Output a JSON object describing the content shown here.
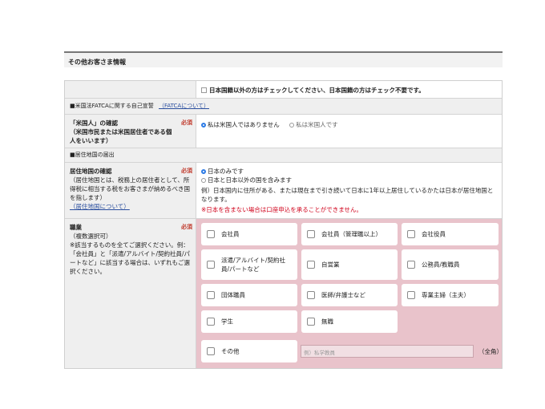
{
  "section_title": "その他お客さま情報",
  "nationality_check_label": "日本国籍以外の方はチェックしてください、日本国籍の方はチェック不要です。",
  "fatca": {
    "label": "■米国法FATCAに関する自己宣誓",
    "link": "（FATCAについて）"
  },
  "us_person": {
    "title": "「米国人」の確認",
    "desc": "（米国市民または米国居住者である個人をいいます）",
    "required": "必須",
    "option_no": "私は米国人ではありません",
    "option_yes": "私は米国人です",
    "selected": "option_no"
  },
  "residence_header": "■居住地国の届出",
  "residence": {
    "title": "居住地国の確認",
    "required": "必須",
    "desc": "（居住地国とは、税務上の居住者として、所得税に相当する税をお客さまが納めるべき国を指します）",
    "link": "（居住地国について）",
    "option_japan": "日本のみです",
    "option_other": "日本と日本以外の国を含みます",
    "example": "例）日本国内に住所がある、または現在まで引き続いて日本に1年以上居住しているかたは日本が居住地国となります。",
    "warning": "※日本を含まない場合は口座申込を承ることができません。",
    "selected": "option_japan"
  },
  "occupation": {
    "title": "職業",
    "required": "必須",
    "desc": "（複数選択可）\n※該当するものを全てご選択ください。例：「会社員」と「派遣/アルバイト/契約社員/パートなど」に該当する場合は、いずれもご選択ください。",
    "options": [
      "会社員",
      "会社員（管理職以上）",
      "会社役員",
      "派遣/アルバイト/契約社員/パートなど",
      "自営業",
      "公務員/教職員",
      "団体職員",
      "医師/弁護士など",
      "専業主婦（主夫）",
      "学生",
      "無職",
      "その他"
    ],
    "other_placeholder": "例）私学教員",
    "zenkaku": "（全角）"
  }
}
